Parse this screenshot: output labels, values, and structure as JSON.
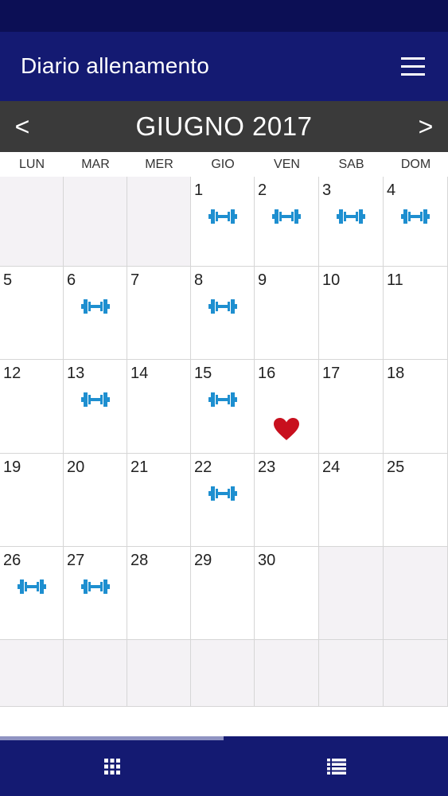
{
  "app": {
    "title": "Diario allenamento",
    "menu_icon": "hamburger-menu-icon",
    "primary_color": "#141a72",
    "status_bar_color": "#0c0f55"
  },
  "calendar": {
    "month_title": "GIUGNO 2017",
    "prev_label": "<",
    "next_label": ">",
    "weekdays": [
      "LUN",
      "MAR",
      "MER",
      "GIO",
      "VEN",
      "SAB",
      "DOM"
    ],
    "workout_icon": "dumbbell-icon",
    "workout_color": "#1e8fd0",
    "special_icon": "heart-icon",
    "special_color": "#c8101e",
    "weeks": [
      [
        {
          "day": null
        },
        {
          "day": null
        },
        {
          "day": null
        },
        {
          "day": "1",
          "icon": "dumbbell"
        },
        {
          "day": "2",
          "icon": "dumbbell"
        },
        {
          "day": "3",
          "icon": "dumbbell"
        },
        {
          "day": "4",
          "icon": "dumbbell"
        }
      ],
      [
        {
          "day": "5"
        },
        {
          "day": "6",
          "icon": "dumbbell"
        },
        {
          "day": "7"
        },
        {
          "day": "8",
          "icon": "dumbbell"
        },
        {
          "day": "9"
        },
        {
          "day": "10"
        },
        {
          "day": "11"
        }
      ],
      [
        {
          "day": "12"
        },
        {
          "day": "13",
          "icon": "dumbbell"
        },
        {
          "day": "14"
        },
        {
          "day": "15",
          "icon": "dumbbell"
        },
        {
          "day": "16",
          "icon": "heart"
        },
        {
          "day": "17"
        },
        {
          "day": "18"
        }
      ],
      [
        {
          "day": "19"
        },
        {
          "day": "20"
        },
        {
          "day": "21"
        },
        {
          "day": "22",
          "icon": "dumbbell"
        },
        {
          "day": "23"
        },
        {
          "day": "24"
        },
        {
          "day": "25"
        }
      ],
      [
        {
          "day": "26",
          "icon": "dumbbell"
        },
        {
          "day": "27",
          "icon": "dumbbell"
        },
        {
          "day": "28"
        },
        {
          "day": "29"
        },
        {
          "day": "30"
        },
        {
          "day": null
        },
        {
          "day": null
        }
      ],
      [
        {
          "day": null
        },
        {
          "day": null
        },
        {
          "day": null
        },
        {
          "day": null
        },
        {
          "day": null
        },
        {
          "day": null
        },
        {
          "day": null
        }
      ]
    ]
  },
  "bottom_nav": {
    "tabs": [
      {
        "icon": "grid-view-icon",
        "selected": true
      },
      {
        "icon": "list-view-icon",
        "selected": false
      }
    ]
  }
}
